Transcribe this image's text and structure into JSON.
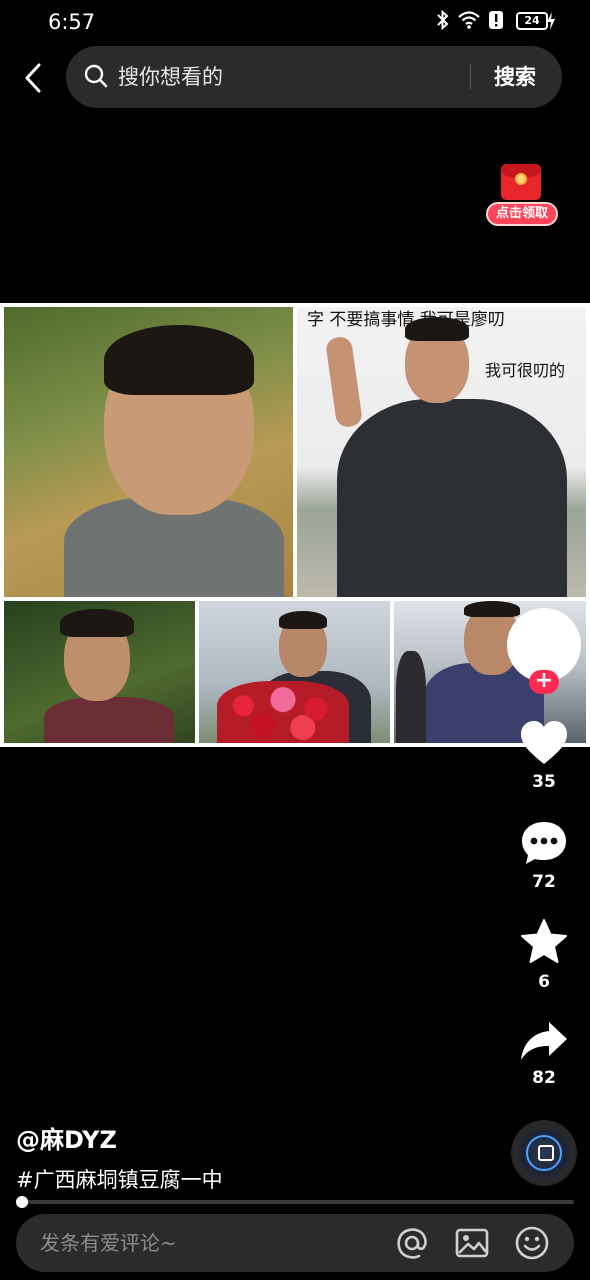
{
  "status_bar": {
    "time": "6:57",
    "battery": "24",
    "icons": [
      "bluetooth-icon",
      "wifi-icon",
      "alert-icon",
      "battery-icon",
      "charging-icon"
    ]
  },
  "search": {
    "placeholder": "搜你想看的",
    "button_label": "搜索"
  },
  "red_packet": {
    "label": "点击领取"
  },
  "video": {
    "caption_top": "字  不要搞事情  我可是廖叨",
    "caption_side": "我可很叨的"
  },
  "actions": {
    "likes": "35",
    "comments": "72",
    "favorites": "6",
    "shares": "82",
    "follow_symbol": "+"
  },
  "post": {
    "author": "@麻DYZ",
    "hashtag": "#广西麻垌镇豆腐一中"
  },
  "playback": {
    "progress": 0.005
  },
  "comment": {
    "placeholder": "发条有爱评论~"
  },
  "colors": {
    "accent": "#fe2c55",
    "bar_bg": "#2b2b2b"
  }
}
